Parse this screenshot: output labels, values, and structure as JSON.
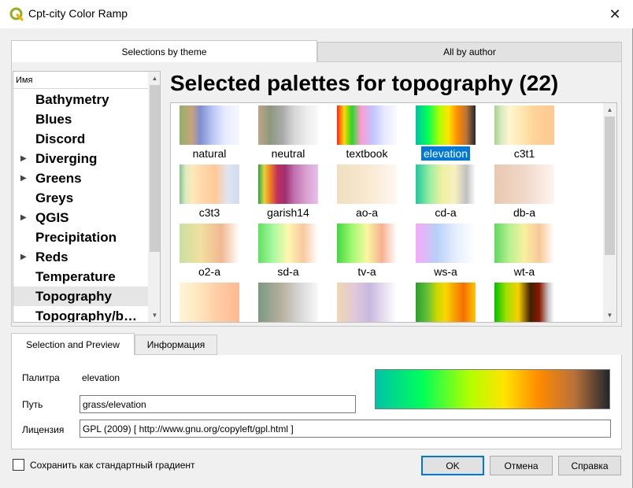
{
  "window": {
    "title": "Cpt-city Color Ramp",
    "close_glyph": "✕"
  },
  "main_tabs": [
    {
      "label": "Selections by theme",
      "active": true
    },
    {
      "label": "All by author",
      "active": false
    }
  ],
  "tree": {
    "header": "Имя",
    "items": [
      {
        "label": "Bathymetry",
        "expandable": false,
        "selected": false
      },
      {
        "label": "Blues",
        "expandable": false,
        "selected": false
      },
      {
        "label": "Discord",
        "expandable": false,
        "selected": false
      },
      {
        "label": "Diverging",
        "expandable": true,
        "selected": false
      },
      {
        "label": "Greens",
        "expandable": true,
        "selected": false
      },
      {
        "label": "Greys",
        "expandable": false,
        "selected": false
      },
      {
        "label": "QGIS",
        "expandable": true,
        "selected": false
      },
      {
        "label": "Precipitation",
        "expandable": false,
        "selected": false
      },
      {
        "label": "Reds",
        "expandable": true,
        "selected": false
      },
      {
        "label": "Temperature",
        "expandable": false,
        "selected": false
      },
      {
        "label": "Topography",
        "expandable": false,
        "selected": true
      },
      {
        "label": "Topography/b…",
        "expandable": false,
        "selected": false
      }
    ]
  },
  "heading": "Selected palettes for topography (22)",
  "palettes": [
    {
      "name": "natural",
      "selected": false,
      "gradient": "linear-gradient(to right, #8fb26a 0%, #c9a27a 20%, #7f8fd0 35%, #b9c4f2 55%, #e6eaff 75%, #f6f8ff 100%)"
    },
    {
      "name": "neutral",
      "selected": false,
      "gradient": "linear-gradient(to right, #bfa58a 0%, #8c9a7c 20%, #a9a9a9 40%, #d6d6d6 60%, #ececec 80%, #f8f8f8 100%)"
    },
    {
      "name": "textbook",
      "selected": false,
      "gradient": "linear-gradient(to right, #ff2020 0%, #ffd800 12%, #28d828 25%, #ff9ad0 40%, #c0c4ff 60%, #e8eaff 80%, #f8f8ff 100%)"
    },
    {
      "name": "elevation",
      "selected": true,
      "gradient": "linear-gradient(to right, #00c2a8 0%, #00ff58 20%, #b0ff00 40%, #ffe400 55%, #ff8a00 70%, #b8723a 85%, #22262c 100%)"
    },
    {
      "name": "c3t1",
      "selected": false,
      "gradient": "linear-gradient(to right, #a8d090 0%, #d8ecc0 12%, #fff6d0 25%, #ffe8b0 45%, #ffd49a 65%, #ffc890 100%)"
    },
    {
      "name": "c3t3",
      "selected": false,
      "gradient": "linear-gradient(to right, #8cc090 0%, #d8ecc0 10%, #ffe8b8 22%, #ffd6a8 40%, #ffc898 60%, #e0e4f0 80%, #d0dcf0 100%)"
    },
    {
      "name": "garish14",
      "selected": false,
      "gradient": "linear-gradient(to right, #20a840 0%, #e8d040 10%, #f08020 20%, #c03060 32%, #a03070 45%, #c070b0 60%, #d8a0d0 80%, #e8c0e8 100%)"
    },
    {
      "name": "ao-a",
      "selected": false,
      "gradient": "linear-gradient(to right, #f0e0c0 0%, #f8e8d0 50%, #fff8f0 100%)"
    },
    {
      "name": "cd-a",
      "selected": false,
      "gradient": "linear-gradient(to right, #20c8a0 0%, #a0f0a0 25%, #f0f0a0 45%, #f8f0c0 65%, #c0c0c0 85%, #ffffff 100%)"
    },
    {
      "name": "db-a",
      "selected": false,
      "gradient": "linear-gradient(to right, #e8c8b0 0%, #f0d8c8 50%, #fff4f0 100%)"
    },
    {
      "name": "o2-a",
      "selected": false,
      "gradient": "linear-gradient(to right, #c8e0a0 0%, #f0e0a0 35%, #f0b890 70%, #ffffff 100%)"
    },
    {
      "name": "sd-a",
      "selected": false,
      "gradient": "linear-gradient(to right, #60e060 0%, #a8f8a0 25%, #fff8b0 50%, #f8c8a0 75%, #ffffff 100%)"
    },
    {
      "name": "tv-a",
      "selected": false,
      "gradient": "linear-gradient(to right, #40d840 0%, #a0f870 25%, #f8f8a0 50%, #f8b090 75%, #ffffff 100%)"
    },
    {
      "name": "ws-a",
      "selected": false,
      "gradient": "linear-gradient(to right, #f8a8f8 0%, #b8d0f8 35%, #e8f0ff 70%, #ffffff 100%)"
    },
    {
      "name": "wt-a",
      "selected": false,
      "gradient": "linear-gradient(to right, #60d860 0%, #b8f090 25%, #f8f0a0 50%, #f8c898 75%, #ffffff 100%)"
    },
    {
      "name": "",
      "selected": false,
      "gradient": "linear-gradient(to right, #fff4d8 0%, #ffe8c0 30%, #ffd0a8 60%, #ffb890 100%)"
    },
    {
      "name": "",
      "selected": false,
      "gradient": "linear-gradient(to right, #7a9a80 0%, #b8b0a0 40%, #d8d8d8 70%, #f8f8f8 100%)"
    },
    {
      "name": "",
      "selected": false,
      "gradient": "linear-gradient(to right, #f0d8b0 0%, #e0c8d8 30%, #c8b8e0 55%, #e8e0f0 80%, #ffffff 100%)"
    },
    {
      "name": "",
      "selected": false,
      "gradient": "linear-gradient(to right, #28a028 0%, #68c038 20%, #c8d800 35%, #f8d800 50%, #f8a000 65%, #f87000 80%, #f8c800 100%)"
    },
    {
      "name": "",
      "selected": false,
      "gradient": "linear-gradient(to right, #00c000 0%, #a0e000 20%, #f8d000 40%, #402000 60%, #8a1800 75%, #c8c8c8 90%, #ffffff 100%)"
    }
  ],
  "sub_tabs": [
    {
      "label": "Selection and Preview",
      "active": true
    },
    {
      "label": "Информация",
      "active": false
    }
  ],
  "details": {
    "palette_label": "Палитра",
    "palette_value": "elevation",
    "path_label": "Путь",
    "path_value": "grass/elevation",
    "license_label": "Лицензия",
    "license_value": "GPL (2009)  [ http://www.gnu.org/copyleft/gpl.html ]"
  },
  "footer": {
    "save_default_label": "Сохранить как стандартный градиент",
    "ok_label": "OK",
    "cancel_label": "Отмена",
    "help_label": "Справка"
  },
  "colors": {
    "selection": "#0078d7",
    "qgis_green": "#93b023"
  }
}
